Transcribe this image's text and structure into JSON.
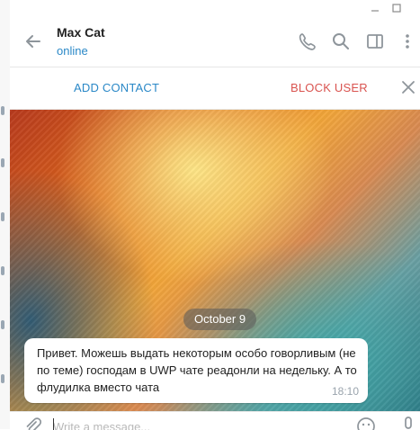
{
  "window": {
    "controls": [
      "minimize-icon",
      "maximize-icon"
    ]
  },
  "header": {
    "peer_name": "Max Cat",
    "peer_status": "online",
    "icons": [
      "back-arrow-icon",
      "phone-icon",
      "search-icon",
      "sidebar-toggle-icon",
      "more-vertical-icon"
    ]
  },
  "action_bar": {
    "add_contact": "ADD CONTACT",
    "block_user": "BLOCK USER",
    "close_icon": "close-icon"
  },
  "chat": {
    "date_separator": "October 9",
    "messages": [
      {
        "text": "Привет. Можешь выдать некоторым особо говорливым (не по теме) господам в UWP чате реадонли на недельку. А то флудилка вместо чата",
        "time": "18:10"
      }
    ]
  },
  "compose": {
    "placeholder": "Write a message...",
    "icons": [
      "attach-icon",
      "emoji-icon",
      "microphone-icon"
    ]
  },
  "colors": {
    "accent": "#2a88c7",
    "danger": "#d9534f"
  }
}
